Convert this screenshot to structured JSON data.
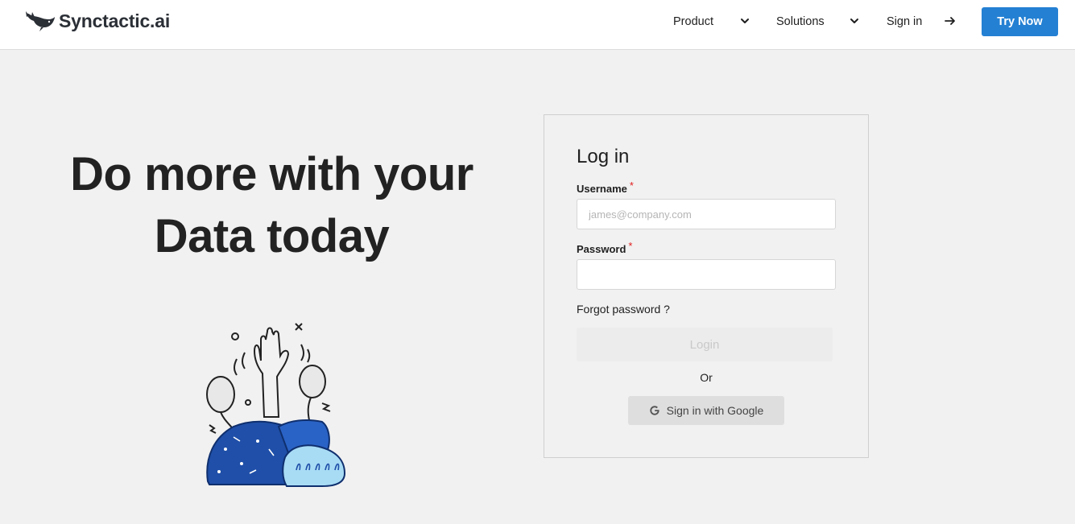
{
  "header": {
    "brand": "Synctactic.ai",
    "nav": {
      "product": "Product",
      "solutions": "Solutions",
      "sign_in": "Sign in"
    },
    "cta": "Try Now"
  },
  "hero": {
    "line1": "Do more with your",
    "line2": "Data today"
  },
  "login": {
    "title": "Log in",
    "username_label": "Username",
    "username_placeholder": "james@company.com",
    "username_value": "",
    "password_label": "Password",
    "password_value": "",
    "required_marker": "*",
    "forgot": "Forgot password ?",
    "login_button": "Login",
    "or": "Or",
    "google_button": "Sign in with Google"
  },
  "colors": {
    "brand_blue": "#2480d3",
    "background": "#f1f1f1",
    "required": "#e02020"
  },
  "icons": [
    "whale-logo-icon",
    "chevron-down-icon",
    "arrow-right-icon",
    "google-g-icon",
    "celebration-illustration"
  ]
}
